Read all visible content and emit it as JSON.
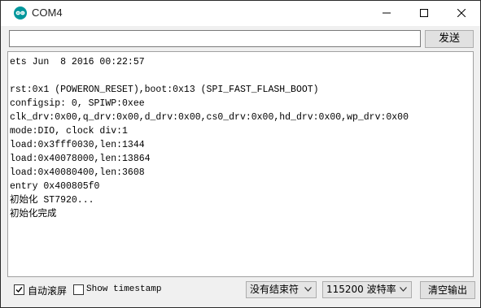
{
  "window": {
    "title": "COM4",
    "accent_color": "#00979c"
  },
  "send": {
    "input_value": "",
    "send_label": "发送"
  },
  "output": {
    "lines": [
      "ets Jun  8 2016 00:22:57",
      "",
      "rst:0x1 (POWERON_RESET),boot:0x13 (SPI_FAST_FLASH_BOOT)",
      "configsip: 0, SPIWP:0xee",
      "clk_drv:0x00,q_drv:0x00,d_drv:0x00,cs0_drv:0x00,hd_drv:0x00,wp_drv:0x00",
      "mode:DIO, clock div:1",
      "load:0x3fff0030,len:1344",
      "load:0x40078000,len:13864",
      "load:0x40080400,len:3608",
      "entry 0x400805f0",
      "初始化 ST7920...",
      "初始化完成"
    ]
  },
  "status": {
    "autoscroll_label": "自动滚屏",
    "autoscroll_checked": true,
    "timestamp_label": "Show timestamp",
    "timestamp_checked": false,
    "line_ending": "没有结束符",
    "baud_rate": "115200 波特率",
    "clear_label": "清空输出"
  }
}
